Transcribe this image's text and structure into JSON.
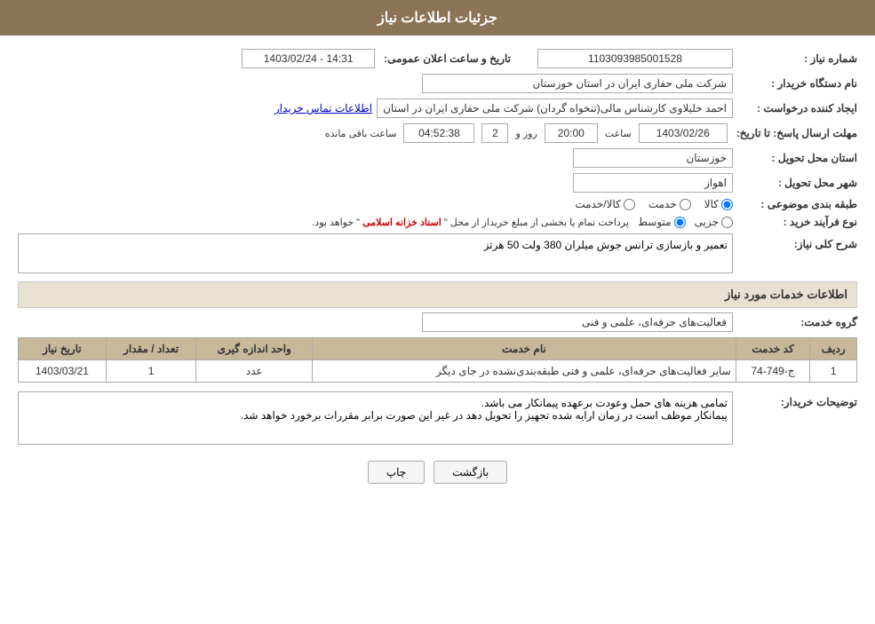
{
  "header": {
    "title": "جزئیات اطلاعات نیاز"
  },
  "fields": {
    "need_number_label": "شماره نیاز :",
    "need_number_value": "1103093985001528",
    "buyer_org_label": "نام دستگاه خریدار :",
    "buyer_org_value": "شرکت ملی حفاری ایران در استان خوزستان",
    "creator_label": "ایجاد کننده درخواست :",
    "creator_value": "احمد خلیلاوی کارشناس مالی(تنخواه گردان) شرکت ملی حفاری ایران در استان",
    "creator_link": "اطلاعات تماس خریدار",
    "announce_label": "تاریخ و ساعت اعلان عمومی:",
    "announce_value": "1403/02/24 - 14:31",
    "deadline_label": "مهلت ارسال پاسخ: تا تاریخ:",
    "deadline_date": "1403/02/26",
    "deadline_time_label": "ساعت",
    "deadline_time": "20:00",
    "deadline_day_label": "روز و",
    "deadline_days": "2",
    "deadline_remaining_label": "ساعت باقی مانده",
    "deadline_remaining": "04:52:38",
    "province_label": "استان محل تحویل :",
    "province_value": "خوزستان",
    "city_label": "شهر محل تحویل :",
    "city_value": "اهواز",
    "category_label": "طبقه بندی موضوعی :",
    "category_options": [
      "کالا",
      "خدمت",
      "کالا/خدمت"
    ],
    "category_selected": "کالا",
    "process_label": "نوع فرآیند خرید :",
    "process_options": [
      "جزیی",
      "متوسط"
    ],
    "process_note": "پرداخت تمام یا بخشی از مبلغ خریدار از محل \"اسناد خزانه اسلامی\" خواهد بود.",
    "description_label": "شرح کلی نیاز:",
    "description_value": "تعمیر و بازسازی ترانس جوش میلران 380 ولت 50 هرتز",
    "services_section_title": "اطلاعات خدمات مورد نیاز",
    "service_group_label": "گروه خدمت:",
    "service_group_value": "فعالیت‌های حرفه‌ای، علمی و فنی",
    "table_headers": [
      "ردیف",
      "کد خدمت",
      "نام خدمت",
      "واحد اندازه گیری",
      "تعداد / مقدار",
      "تاریخ نیاز"
    ],
    "table_rows": [
      {
        "row": "1",
        "code": "ج-749-74",
        "name": "سایر فعالیت‌های حرفه‌ای، علمی و فنی طبقه‌بندی‌نشده در جای دیگر",
        "unit": "عدد",
        "quantity": "1",
        "date": "1403/03/21"
      }
    ],
    "buyer_notes_label": "توضیحات خریدار:",
    "buyer_notes_value": "تمامی هزینه های حمل وعودت برعهده پیمانکار می باشد.\nپیمانکار موظف است در زمان ارایه شده تجهیز را تحویل دهد در غیر این صورت برابر مقررات برخورد خواهد شد.",
    "buttons": {
      "print": "چاپ",
      "back": "بازگشت"
    }
  }
}
